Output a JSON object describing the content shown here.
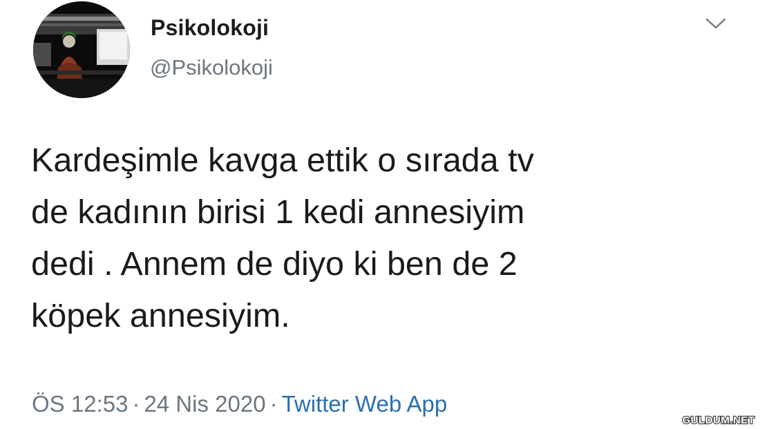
{
  "profile": {
    "display_name": "Psikolokoji",
    "handle": "@Psikolokoji"
  },
  "tweet": {
    "lines": [
      "Kardeşimle kavga ettik o sırada tv",
      "de kadının birisi 1 kedi annesiyim",
      "dedi . Annem de diyo ki ben de 2",
      "köpek annesiyim."
    ]
  },
  "meta": {
    "time": "ÖS 12:53",
    "separator": "·",
    "date": "24 Nis 2020",
    "source": "Twitter Web App"
  },
  "watermark": {
    "text": "GULDUM.NET"
  },
  "icons": {
    "avatar": "avatar-image",
    "menu": "chevron-down-icon"
  },
  "colors": {
    "text": "#1a1a1a",
    "secondary": "#6b7680",
    "link": "#2a6fae"
  }
}
